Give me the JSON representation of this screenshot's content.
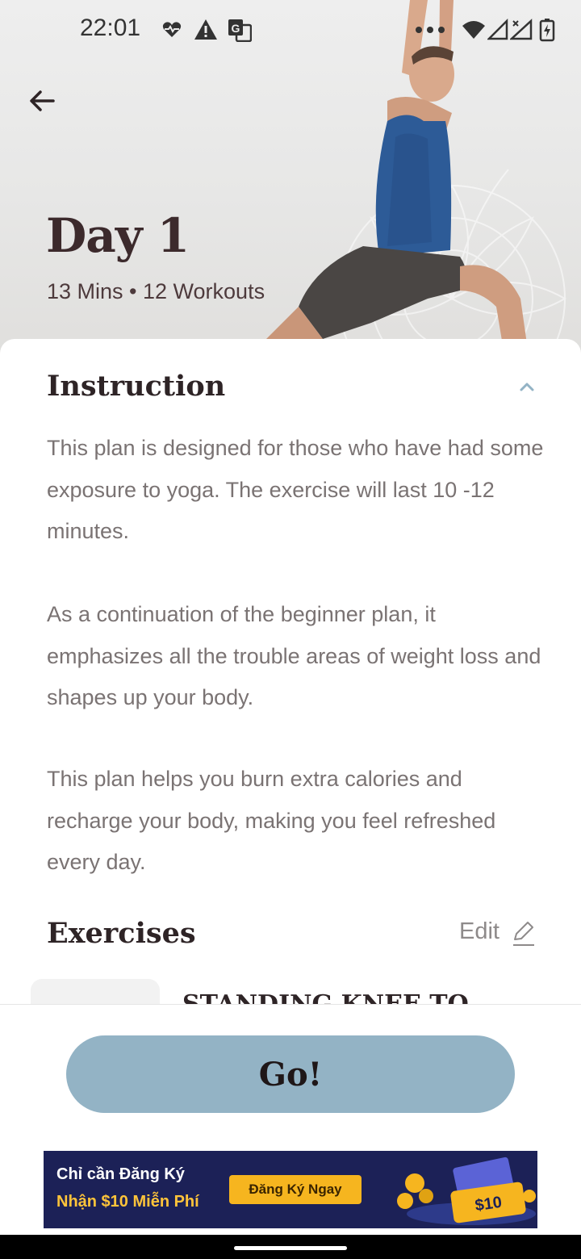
{
  "status_bar": {
    "time": "22:01",
    "left_icons": [
      "heart-pulse-icon",
      "alert-icon",
      "translate-icon"
    ],
    "right_icons": [
      "more-dots-icon",
      "wifi-icon",
      "signal-icon",
      "signal-x-icon",
      "battery-charging-icon"
    ]
  },
  "hero": {
    "back_icon": "arrow-left-icon",
    "title": "Day 1",
    "subtitle": "13 Mins • 12 Workouts"
  },
  "instruction": {
    "heading": "Instruction",
    "toggle_icon": "chevron-up-icon",
    "paragraphs": [
      "This plan is designed for those who have had some exposure to yoga. The exercise will last 10 -12 minutes.",
      "As a continuation of the beginner plan, it emphasizes all the trouble areas of weight loss and shapes up your body.",
      "This plan helps you burn extra calories and recharge your body, making you feel refreshed every day."
    ]
  },
  "exercises": {
    "heading": "Exercises",
    "edit_label": "Edit",
    "edit_icon": "pencil-icon",
    "first_item_title": "STANDING KNEE TO"
  },
  "go_button": {
    "label": "Go!"
  },
  "ad": {
    "line1": "Chỉ cần Đăng Ký",
    "line2": "Nhận $10 Miễn Phí",
    "cta": "Đăng Ký Ngay",
    "amount": "$10"
  },
  "colors": {
    "accent": "#93b3c5",
    "title_text": "#3c2a2c",
    "body_text": "#7a7373",
    "ad_background": "#1c2157",
    "ad_cta": "#f6b51f"
  }
}
